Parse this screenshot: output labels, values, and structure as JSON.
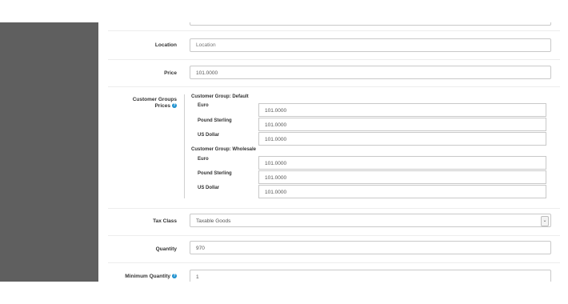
{
  "form": {
    "location": {
      "label": "Location",
      "placeholder": "Location"
    },
    "price": {
      "label": "Price",
      "value": "101.0000"
    },
    "customer_group_prices": {
      "label_line1": "Customer Groups",
      "label_line2": "Prices",
      "groups": [
        {
          "title": "Customer Group: Default",
          "currencies": [
            {
              "name": "Euro",
              "value": "101.0000"
            },
            {
              "name": "Pound Sterling",
              "value": "101.0000"
            },
            {
              "name": "US Dollar",
              "value": "101.0000"
            }
          ]
        },
        {
          "title": "Customer Group: Wholesale",
          "currencies": [
            {
              "name": "Euro",
              "value": "101.0000"
            },
            {
              "name": "Pound Sterling",
              "value": "101.0000"
            },
            {
              "name": "US Dollar",
              "value": "101.0000"
            }
          ]
        }
      ]
    },
    "tax_class": {
      "label": "Tax Class",
      "value": "Taxable Goods"
    },
    "quantity": {
      "label": "Quantity",
      "value": "970"
    },
    "minimum_quantity": {
      "label": "Minimum Quantity",
      "value": "1"
    }
  },
  "icons": {
    "help": "question-circle-icon",
    "select": "chevron-down-icon"
  }
}
